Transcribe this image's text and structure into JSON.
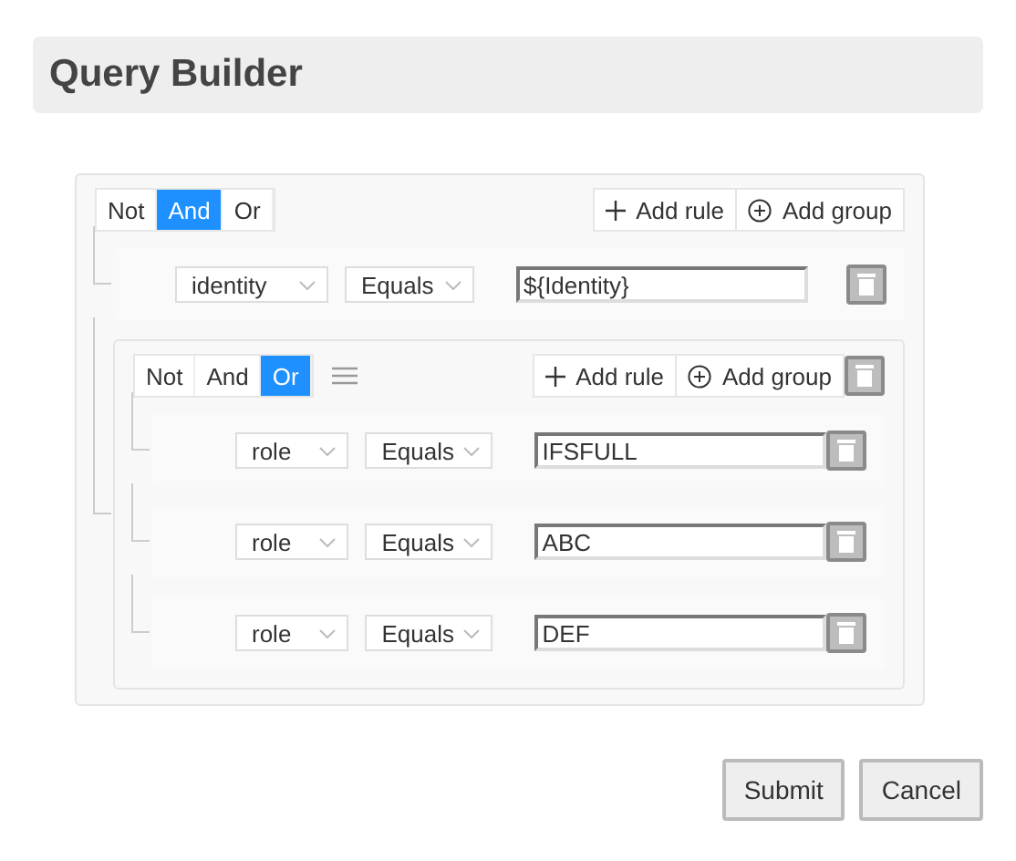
{
  "dialog": {
    "title": "Query Builder",
    "query": {
      "conjunctions": [
        {
          "label": "Not",
          "selected": false
        },
        {
          "label": "And",
          "selected": true
        },
        {
          "label": "Or",
          "selected": false
        }
      ],
      "actions": [
        {
          "kind": "rule",
          "label": "Add rule"
        },
        {
          "kind": "group",
          "label": "Add group"
        }
      ],
      "children": [
        {
          "kind": "rule",
          "field": "identity",
          "operator": "Equals",
          "value": "${Identity}"
        },
        {
          "kind": "group",
          "conjunctions": [
            {
              "label": "Not",
              "selected": false
            },
            {
              "label": "And",
              "selected": false
            },
            {
              "label": "Or",
              "selected": true
            }
          ],
          "actions": [
            {
              "kind": "rule",
              "label": "Add rule"
            },
            {
              "kind": "group",
              "label": "Add group"
            }
          ],
          "children": [
            {
              "kind": "rule",
              "field": "role",
              "operator": "Equals",
              "value": "IFSFULL"
            },
            {
              "kind": "rule",
              "field": "role",
              "operator": "Equals",
              "value": "ABC"
            },
            {
              "kind": "rule",
              "field": "role",
              "operator": "Equals",
              "value": "DEF"
            }
          ]
        }
      ]
    },
    "buttons": [
      {
        "label": "Submit"
      },
      {
        "label": "Cancel"
      }
    ]
  }
}
